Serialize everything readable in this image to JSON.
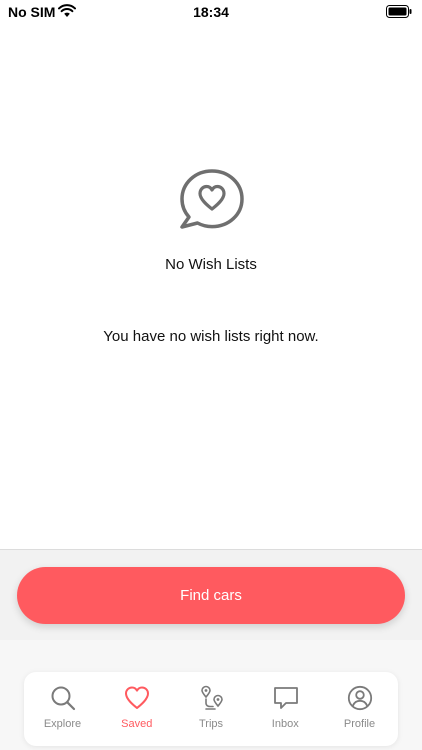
{
  "status_bar": {
    "carrier": "No SIM",
    "time": "18:34"
  },
  "empty_state": {
    "icon": "heart-chat-bubble-icon",
    "title": "No Wish Lists",
    "message": "You have no wish lists right now."
  },
  "action": {
    "button_label": "Find cars"
  },
  "tab_bar": {
    "items": [
      {
        "label": "Explore",
        "icon": "search-icon",
        "active": false
      },
      {
        "label": "Saved",
        "icon": "heart-icon",
        "active": true
      },
      {
        "label": "Trips",
        "icon": "route-pins-icon",
        "active": false
      },
      {
        "label": "Inbox",
        "icon": "chat-bubble-icon",
        "active": false
      },
      {
        "label": "Profile",
        "icon": "user-circle-icon",
        "active": false
      }
    ]
  },
  "colors": {
    "accent": "#ff5a5f",
    "inactive": "#8a8a8a",
    "icon_gray": "#6f6f6f"
  }
}
